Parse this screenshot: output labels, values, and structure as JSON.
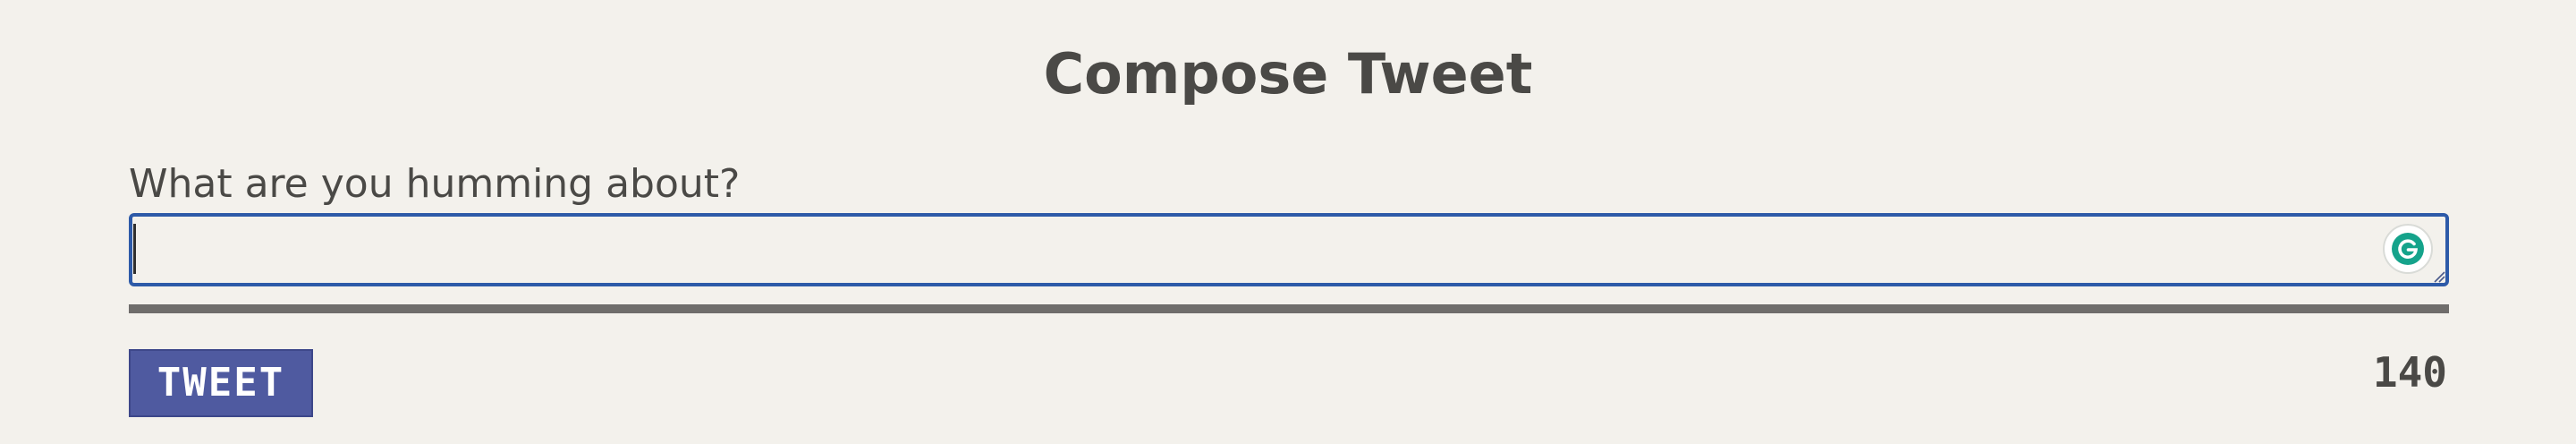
{
  "header": {
    "title": "Compose Tweet"
  },
  "composer": {
    "prompt_label": "What are you humming about?",
    "input_value": "",
    "input_placeholder": "",
    "character_limit_remaining": "140",
    "progress_fraction": 1.0,
    "submit_label": "TWEET"
  },
  "colors": {
    "background": "#f3f1ec",
    "text": "#4a4946",
    "input_border": "#2d5aa8",
    "progress_bar": "#858381",
    "button_background": "#4f5aa0",
    "button_text": "#ffffff",
    "grammarly_icon": "#15a38b"
  },
  "icons": {
    "grammarly": "grammarly-icon",
    "resize": "resize-handle-icon"
  }
}
